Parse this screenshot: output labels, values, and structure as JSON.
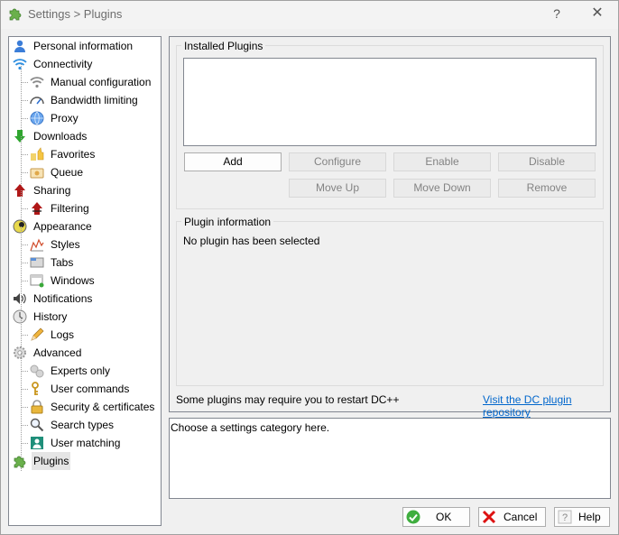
{
  "window": {
    "title": "Settings > Plugins",
    "help_glyph": "?",
    "close_glyph": "✕"
  },
  "tree": {
    "items": [
      {
        "label": "Personal information",
        "icon": "person-icon"
      },
      {
        "label": "Connectivity",
        "icon": "wifi-icon"
      },
      {
        "label": "Manual configuration",
        "icon": "wifi-gray-icon"
      },
      {
        "label": "Bandwidth limiting",
        "icon": "gauge-icon"
      },
      {
        "label": "Proxy",
        "icon": "globe-icon"
      },
      {
        "label": "Downloads",
        "icon": "download-arrow-icon"
      },
      {
        "label": "Favorites",
        "icon": "favorites-icon"
      },
      {
        "label": "Queue",
        "icon": "queue-icon"
      },
      {
        "label": "Sharing",
        "icon": "upload-arrow-icon"
      },
      {
        "label": "Filtering",
        "icon": "filter-arrow-icon"
      },
      {
        "label": "Appearance",
        "icon": "palette-icon"
      },
      {
        "label": "Styles",
        "icon": "styles-chart-icon"
      },
      {
        "label": "Tabs",
        "icon": "tabs-icon"
      },
      {
        "label": "Windows",
        "icon": "windows-icon"
      },
      {
        "label": "Notifications",
        "icon": "speaker-icon"
      },
      {
        "label": "History",
        "icon": "clock-icon"
      },
      {
        "label": "Logs",
        "icon": "pencil-icon"
      },
      {
        "label": "Advanced",
        "icon": "gear-icon"
      },
      {
        "label": "Experts only",
        "icon": "gears-icon"
      },
      {
        "label": "User commands",
        "icon": "key-icon"
      },
      {
        "label": "Security & certificates",
        "icon": "lock-icon"
      },
      {
        "label": "Search types",
        "icon": "magnifier-icon"
      },
      {
        "label": "User matching",
        "icon": "user-card-icon"
      },
      {
        "label": "Plugins",
        "icon": "puzzle-icon"
      }
    ],
    "selected": "Plugins"
  },
  "plugins": {
    "installed_title": "Installed Plugins",
    "buttons": {
      "add": "Add",
      "configure": "Configure",
      "enable": "Enable",
      "disable": "Disable",
      "move_up": "Move Up",
      "move_down": "Move Down",
      "remove": "Remove"
    },
    "info_title": "Plugin information",
    "info_text": "No plugin has been selected",
    "restart_note": "Some plugins may require you to restart DC++",
    "repo_link": "Visit the DC plugin repository"
  },
  "description": "Choose a settings category here.",
  "footer": {
    "ok": "OK",
    "cancel": "Cancel",
    "help": "Help"
  },
  "colors": {
    "link": "#0066cc",
    "selection": "#e5e5e5",
    "disabled_text": "#838383"
  }
}
